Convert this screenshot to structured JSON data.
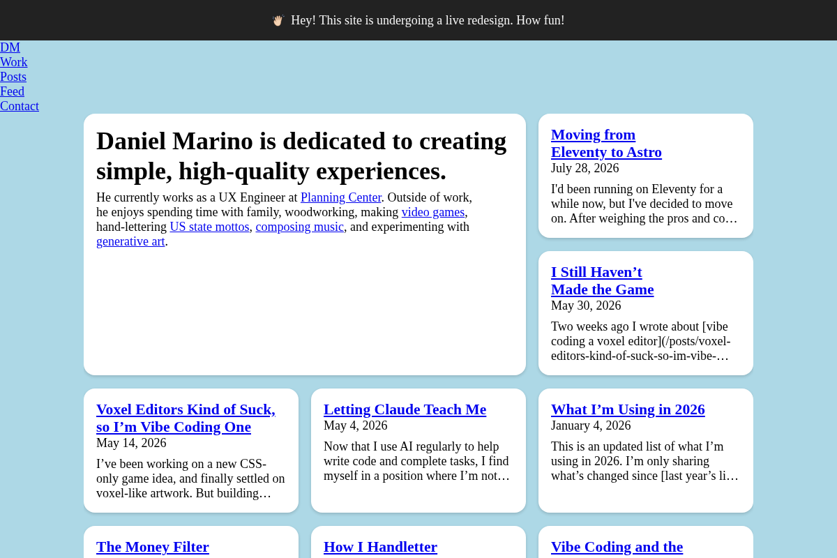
{
  "banner": {
    "text": "Hey! This site is undergoing a live redesign. How fun!"
  },
  "nav": [
    {
      "label": "DM"
    },
    {
      "label": "Work"
    },
    {
      "label": "Posts"
    },
    {
      "label": "Feed"
    },
    {
      "label": "Contact"
    }
  ],
  "intro": {
    "heading": "Daniel Marino is dedicated to creating simple, high-quality experiences.",
    "paragraph": [
      {
        "kind": "text",
        "text": "He currently works as a UX Engineer at "
      },
      {
        "kind": "link",
        "text": "Planning Center"
      },
      {
        "kind": "text",
        "text": ". Outside of work, he enjoys spending time with family, woodworking, making "
      },
      {
        "kind": "link",
        "text": "video games"
      },
      {
        "kind": "text",
        "text": ", hand-lettering "
      },
      {
        "kind": "link",
        "text": "US state mottos"
      },
      {
        "kind": "text",
        "text": ", "
      },
      {
        "kind": "link",
        "text": "composing music"
      },
      {
        "kind": "text",
        "text": ", and experimenting with "
      },
      {
        "kind": "link",
        "text": "generative art"
      },
      {
        "kind": "text",
        "text": "."
      }
    ]
  },
  "posts": [
    {
      "title": "Moving from Eleventy to Astro",
      "date": "July 28, 2026",
      "excerpt": "I'd been running on Eleventy for a while now, but I've decided to move on. After weighing the pros and co…"
    },
    {
      "title": "I Still Haven’t Made the Game",
      "date": "May 30, 2026",
      "excerpt": "Two weeks ago I wrote about [vibe coding a voxel editor](/posts/voxel-editors-kind-of-suck-so-im-vibe-…"
    },
    {
      "title": "Voxel Editors Kind of Suck, so I’m Vibe Coding One",
      "date": "May 14, 2026",
      "excerpt": "I’ve been working on a new CSS-only game idea, and finally settled on voxel-like artwork. But building…"
    },
    {
      "title": "Letting Claude Teach Me",
      "date": "May 4, 2026",
      "excerpt": "Now that I use AI regularly to help write code and complete tasks, I find myself in a position where I’m not…"
    },
    {
      "title": "What I’m Using in 2026",
      "date": "January 4, 2026",
      "excerpt": "This is an updated list of what I’m using in 2026. I’m only sharing what’s changed since [last year’s li…"
    },
    {
      "title": "The Money Filter"
    },
    {
      "title": "How I Handletter"
    },
    {
      "title": "Vibe Coding and the"
    }
  ]
}
